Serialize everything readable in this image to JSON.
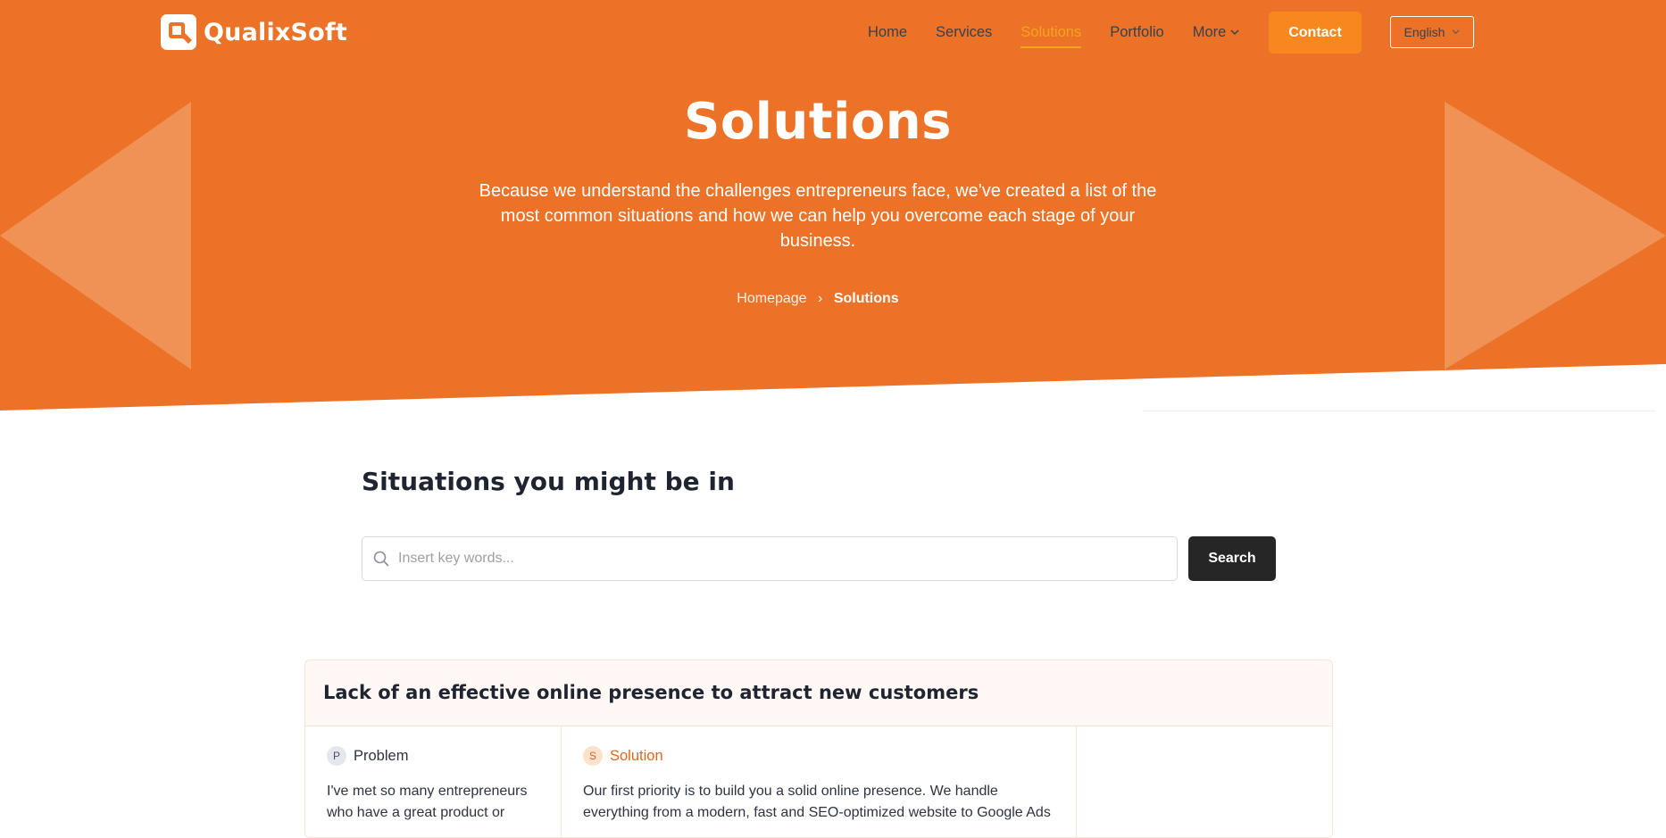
{
  "brand": {
    "name": "QualixSoft"
  },
  "nav": {
    "items": [
      {
        "label": "Home",
        "active": false
      },
      {
        "label": "Services",
        "active": false
      },
      {
        "label": "Solutions",
        "active": true
      },
      {
        "label": "Portfolio",
        "active": false
      }
    ],
    "more_label": "More",
    "contact_label": "Contact",
    "language": "English"
  },
  "hero": {
    "title": "Solutions",
    "subtitle": "Because we understand the challenges entrepreneurs face, we've created a list of the most common situations and how we can help you overcome each stage of your business.",
    "breadcrumb": {
      "home": "Homepage",
      "separator": "›",
      "current": "Solutions"
    }
  },
  "situations": {
    "title": "Situations you might be in",
    "search_placeholder": "Insert key words...",
    "search_value": "",
    "search_button": "Search"
  },
  "card": {
    "title": "Lack of an effective online presence to attract new customers",
    "problem": {
      "badge": "P",
      "label": "Problem",
      "text": "I've met so many entrepreneurs who have a great product or"
    },
    "solution": {
      "badge": "S",
      "label": "Solution",
      "text": "Our first priority is to build you a solid online presence. We handle everything from a modern, fast and SEO-optimized website to Google Ads"
    }
  },
  "colors": {
    "hero_orange": "#ec7227",
    "accent_orange": "#f7871e",
    "active_nav": "#f6a31d",
    "dark_button": "#262626"
  },
  "icons": [
    "logo-mark-icon",
    "chevron-down-icon",
    "search-icon",
    "triangle-left-decoration",
    "triangle-right-decoration"
  ]
}
